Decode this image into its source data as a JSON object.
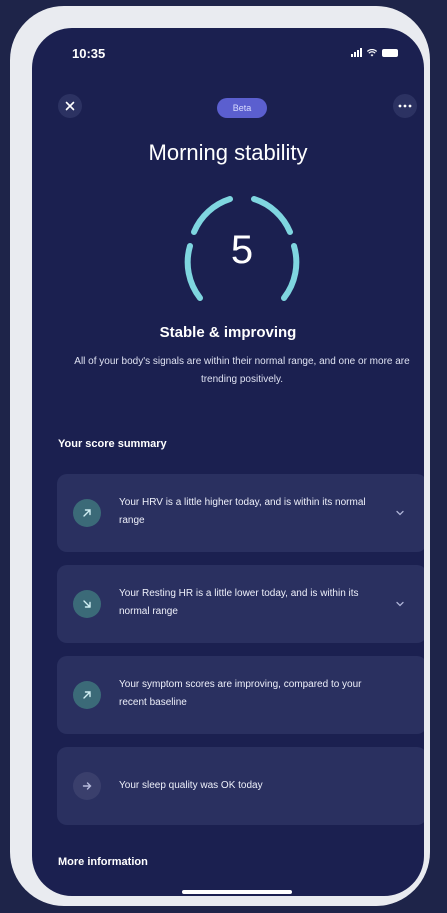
{
  "status_bar": {
    "time": "10:35"
  },
  "header": {
    "badge": "Beta",
    "title": "Morning stability"
  },
  "score": {
    "value": "5",
    "gauge_color": "#7fd6e0",
    "status_title": "Stable & improving",
    "status_description": "All of your body's signals are within their normal range, and one or more are trending positively."
  },
  "summary": {
    "heading": "Your score summary",
    "items": [
      {
        "text": "Your HRV is a little higher today, and is within its normal range",
        "icon": "arrow-up-right-icon",
        "expandable": true
      },
      {
        "text": "Your Resting HR is a little lower today, and is within its normal range",
        "icon": "arrow-down-right-icon",
        "expandable": true
      },
      {
        "text": "Your symptom scores are improving, compared to your recent baseline",
        "icon": "arrow-up-right-icon",
        "expandable": false
      },
      {
        "text": "Your sleep quality was OK today",
        "icon": "arrow-right-icon",
        "expandable": false
      }
    ]
  },
  "more_info": {
    "heading": "More information"
  },
  "colors": {
    "screen_bg": "#1b2050",
    "card_bg": "#2a3060",
    "badge_bg": "#5b5fcf",
    "positive_icon_bg": "#3b6a78",
    "neutral_icon_bg": "#3a3f6c"
  }
}
